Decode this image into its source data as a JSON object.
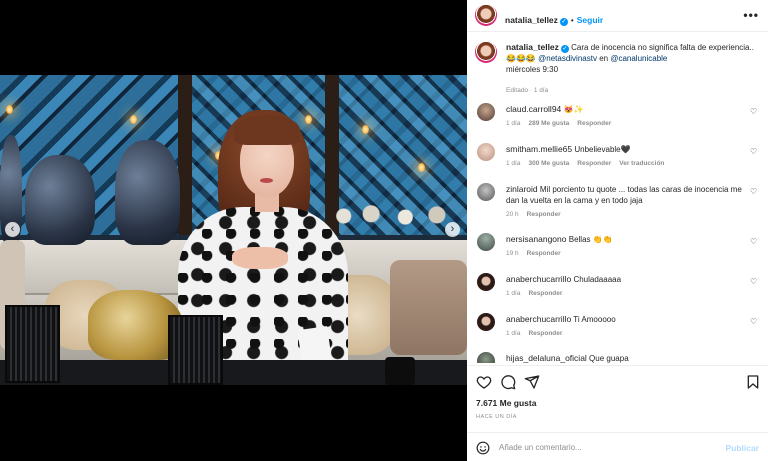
{
  "post": {
    "username": "natalia_tellez",
    "follow_label": "Seguir",
    "more_label": "•••",
    "caption_user": "natalia_tellez",
    "caption_text_1": "Cara de inocencia no significa falta de experiencia.. 😂😂😂",
    "caption_mention_1": "@netasdivinastv",
    "caption_text_2": "en",
    "caption_mention_2": "@canalunicable",
    "caption_text_3": "miércoles 9:30",
    "edited_label": "Editado · 1 día",
    "likes": "7.671 Me gusta",
    "date": "HACE UN DÍA",
    "comment_placeholder": "Añade un comentario...",
    "publish_label": "Publicar"
  },
  "comments": [
    {
      "user": "claud.carroll94",
      "text": "😻✨",
      "time": "1 día",
      "likes": "289 Me gusta",
      "reply": "Responder",
      "extra": ""
    },
    {
      "user": "smitham.mellie65",
      "text": "Unbelievable🖤",
      "time": "1 día",
      "likes": "300 Me gusta",
      "reply": "Responder",
      "extra": "Ver traducción"
    },
    {
      "user": "zinlaroid",
      "text": "Mil porciento tu quote ... todas las caras de inocencia me dan la vuelta en la cama y en todo jaja",
      "time": "20 h",
      "likes": "",
      "reply": "Responder",
      "extra": ""
    },
    {
      "user": "nersisanangono",
      "text": "Bellas 👏👏",
      "time": "19 h",
      "likes": "",
      "reply": "Responder",
      "extra": ""
    },
    {
      "user": "anaberchucarrillo",
      "text": "Chuladaaaaa",
      "time": "1 día",
      "likes": "",
      "reply": "Responder",
      "extra": ""
    },
    {
      "user": "anaberchucarrillo",
      "text": "Ti Amooooo",
      "time": "1 día",
      "likes": "",
      "reply": "Responder",
      "extra": ""
    },
    {
      "user": "hijas_delaluna_oficial",
      "text": "Que guapa",
      "time": "",
      "likes": "",
      "reply": "",
      "extra": ""
    }
  ],
  "icons": {
    "heart": "heart-icon",
    "comment": "comment-icon",
    "share": "share-icon",
    "save": "bookmark-icon",
    "emoji": "emoji-icon"
  },
  "colors": {
    "accent": "#0095f6",
    "muted": "#8e8e8e",
    "publish_disabled": "#b3dbff"
  }
}
